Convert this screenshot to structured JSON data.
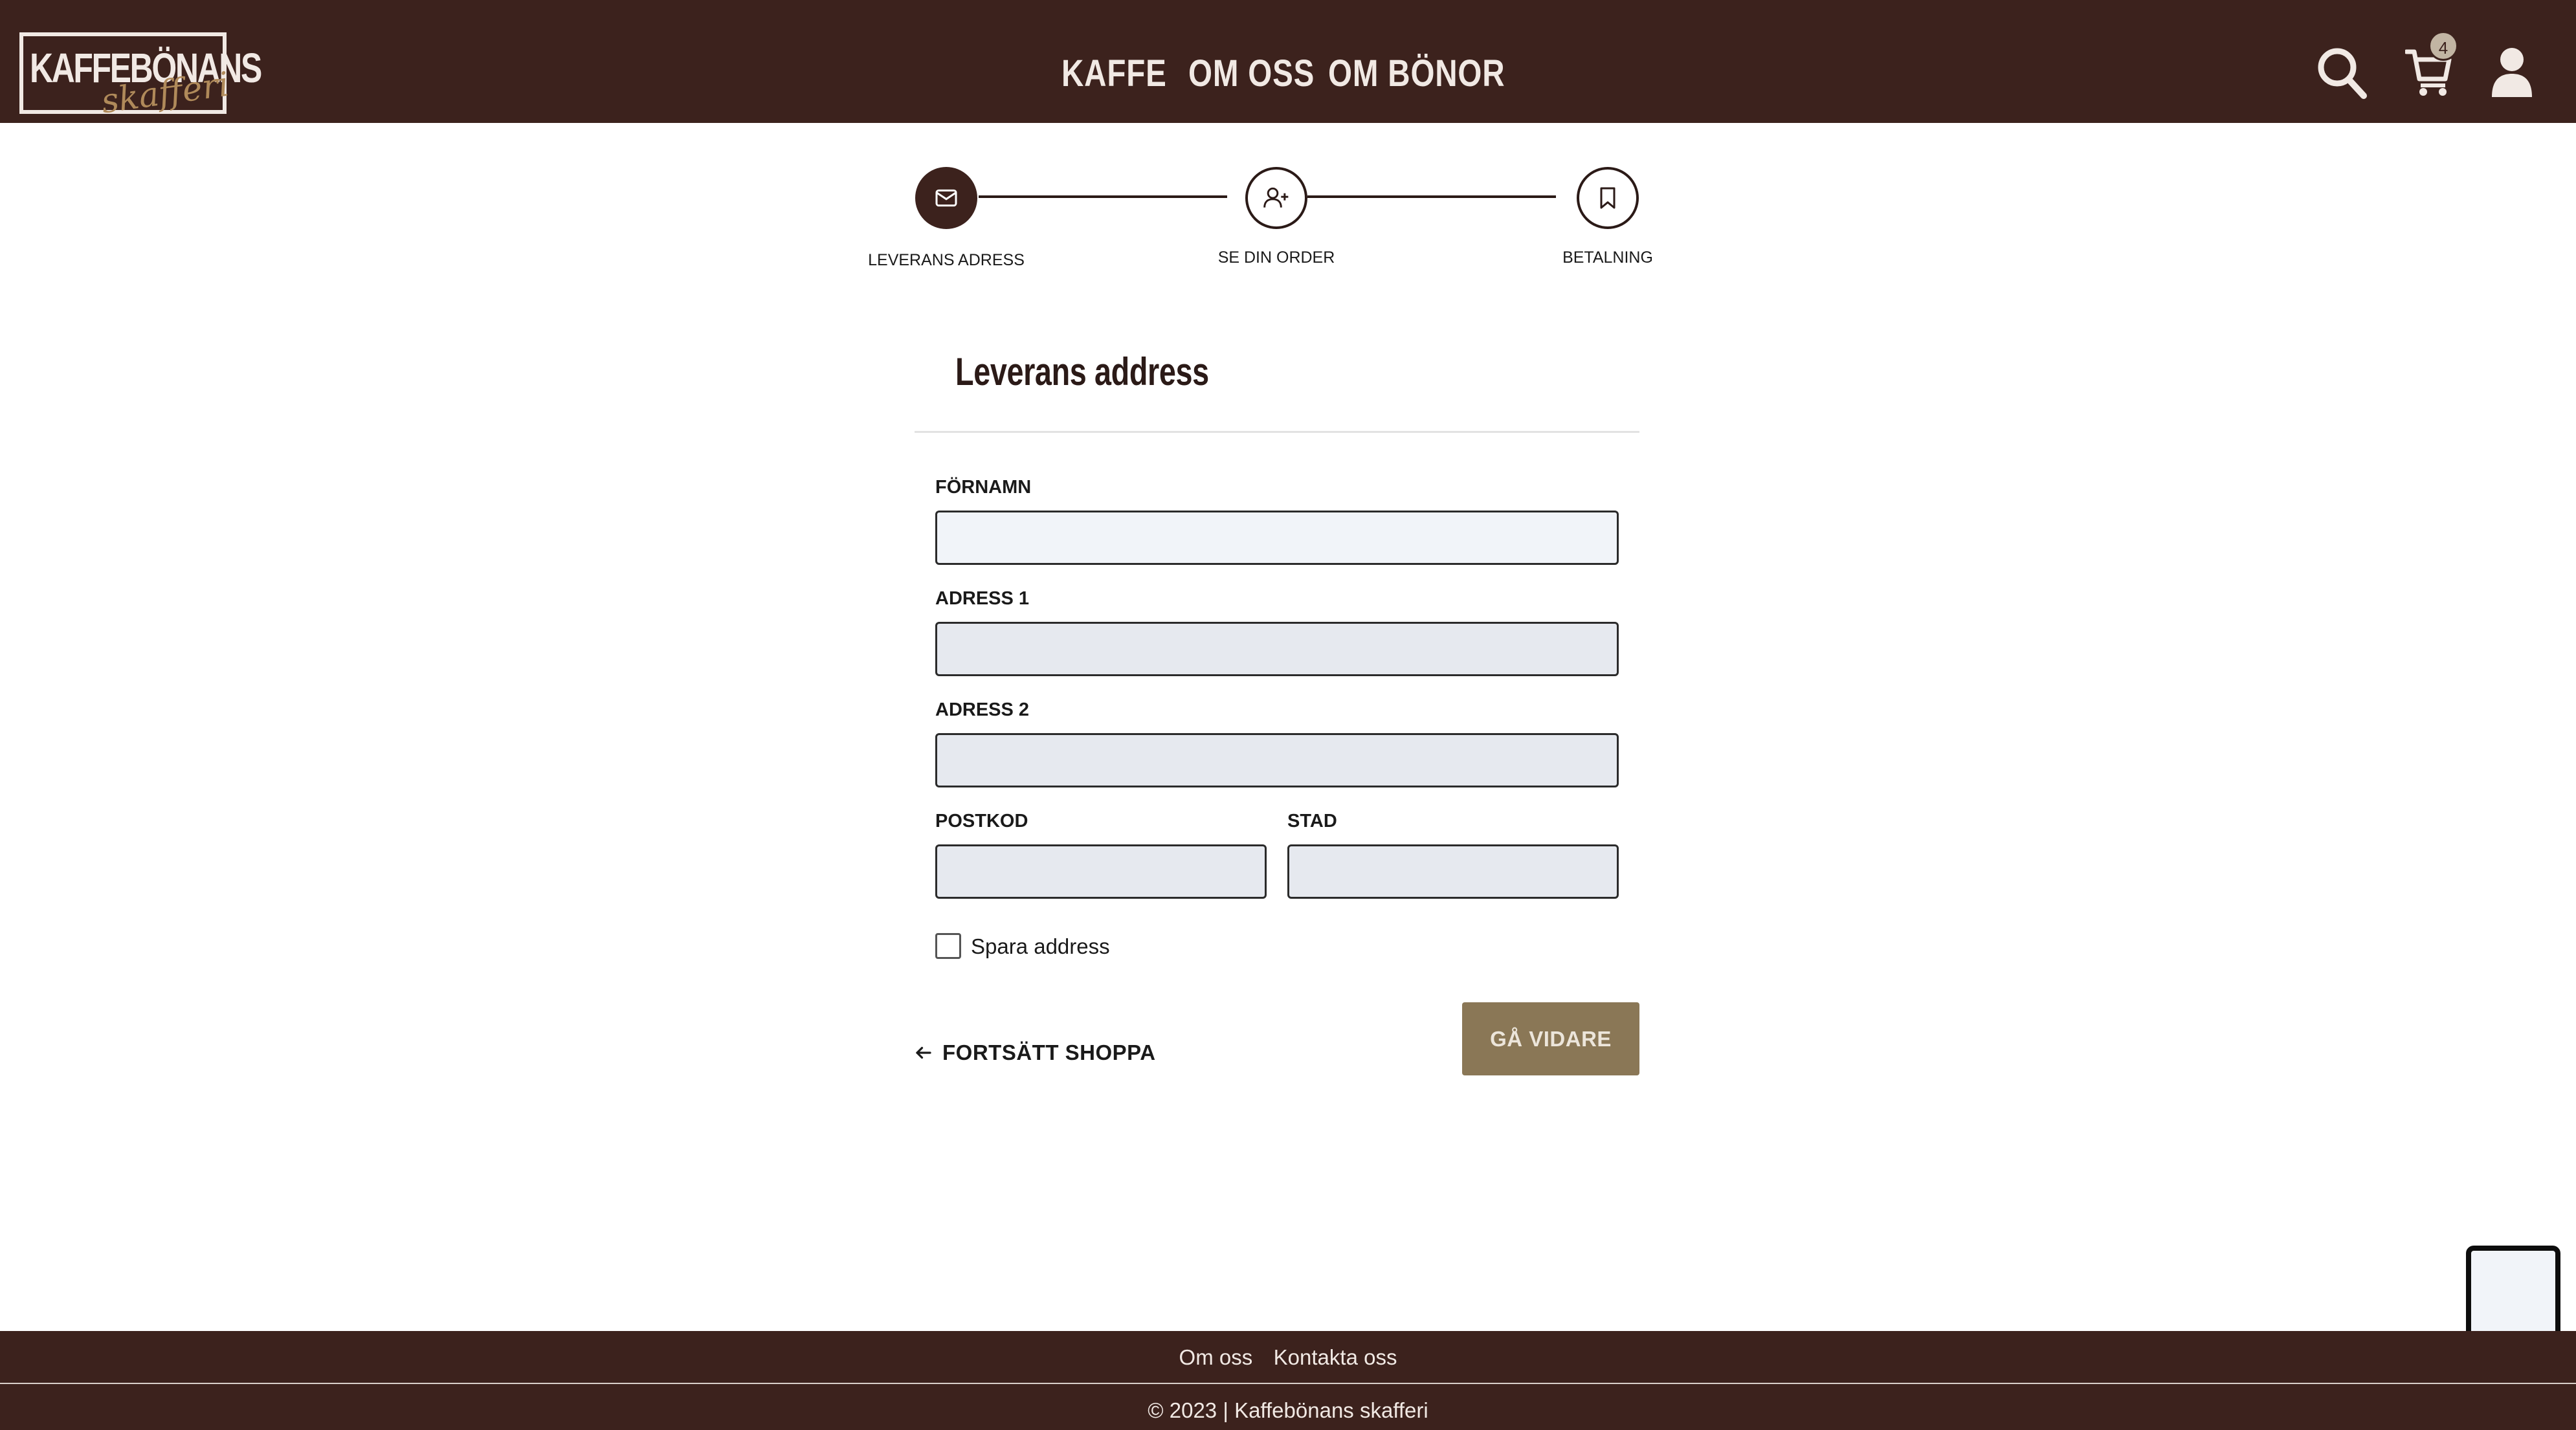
{
  "header": {
    "logo_main": "KAFFEBÖNANS",
    "logo_script": "skafferi",
    "nav": [
      "KAFFE",
      "OM OSS",
      "OM BÖNOR"
    ],
    "cart_count": "4"
  },
  "stepper": {
    "steps": [
      {
        "label": "LEVERANS ADRESS",
        "icon": "mail-icon",
        "active": true
      },
      {
        "label": "SE DIN ORDER",
        "icon": "user-plus-icon",
        "active": false
      },
      {
        "label": "BETALNING",
        "icon": "bookmark-icon",
        "active": false
      }
    ]
  },
  "form": {
    "title": "Leverans address",
    "fields": {
      "first_name": {
        "label": "FÖRNAMN",
        "value": ""
      },
      "address1": {
        "label": "ADRESS 1",
        "value": ""
      },
      "address2": {
        "label": "ADRESS 2",
        "value": ""
      },
      "postcode": {
        "label": "POSTKOD",
        "value": ""
      },
      "city": {
        "label": "STAD",
        "value": ""
      }
    },
    "save_address_label": "Spara address",
    "back_label": "FORTSÄTT SHOPPA",
    "continue_label": "GÅ VIDARE"
  },
  "footer": {
    "links": [
      "Om oss",
      "Kontakta oss"
    ],
    "copyright": "© 2023 | Kaffebönans skafferi"
  },
  "colors": {
    "brand_dark": "#3c221d",
    "accent": "#8a7756",
    "input_bg": "#e6e9ef"
  }
}
